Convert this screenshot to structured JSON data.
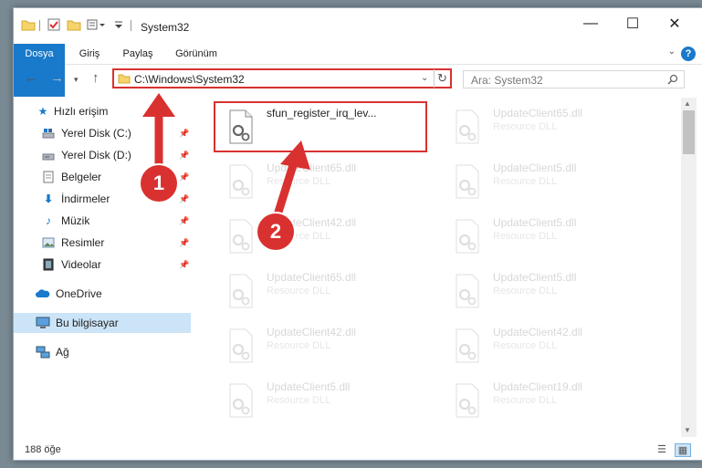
{
  "window": {
    "title": "System32",
    "minimize": "—",
    "maximize": "☐",
    "close": "✕"
  },
  "ribbon": {
    "tabs": [
      "Dosya",
      "Giriş",
      "Paylaş",
      "Görünüm"
    ],
    "help": "?",
    "collapse": "⌄"
  },
  "nav": {
    "address": "C:\\Windows\\System32",
    "search_placeholder": "Ara: System32"
  },
  "sidebar": {
    "items": [
      {
        "label": "Hızlı erişim",
        "icon": "star-icon",
        "pinned": false
      },
      {
        "label": "Yerel Disk (C:)",
        "icon": "drive-icon",
        "pinned": true
      },
      {
        "label": "Yerel Disk (D:)",
        "icon": "drive-icon",
        "pinned": true
      },
      {
        "label": "Belgeler",
        "icon": "documents-icon",
        "pinned": true
      },
      {
        "label": "İndirmeler",
        "icon": "download-icon",
        "pinned": true
      },
      {
        "label": "Müzik",
        "icon": "music-icon",
        "pinned": true
      },
      {
        "label": "Resimler",
        "icon": "pictures-icon",
        "pinned": true
      },
      {
        "label": "Videolar",
        "icon": "videos-icon",
        "pinned": true
      },
      {
        "label": "OneDrive",
        "icon": "cloud-icon",
        "pinned": false
      },
      {
        "label": "Bu bilgisayar",
        "icon": "computer-icon",
        "pinned": false,
        "selected": true
      },
      {
        "label": "Ağ",
        "icon": "network-icon",
        "pinned": false
      }
    ]
  },
  "files": [
    {
      "name": "sfun_register_irq_lev...",
      "type": ""
    },
    {
      "name": "UpdateClient65.dll",
      "type": "Resource DLL"
    },
    {
      "name": "UpdateClient65.dll",
      "type": "Resource DLL"
    },
    {
      "name": "UpdateClient5.dll",
      "type": "Resource DLL"
    },
    {
      "name": "UpdateClient42.dll",
      "type": "Resource DLL"
    },
    {
      "name": "UpdateClient5.dll",
      "type": "Resource DLL"
    },
    {
      "name": "UpdateClient65.dll",
      "type": "Resource DLL"
    },
    {
      "name": "UpdateClient5.dll",
      "type": "Resource DLL"
    },
    {
      "name": "UpdateClient42.dll",
      "type": "Resource DLL"
    },
    {
      "name": "UpdateClient42.dll",
      "type": "Resource DLL"
    },
    {
      "name": "UpdateClient5.dll",
      "type": "Resource DLL"
    },
    {
      "name": "UpdateClient19.dll",
      "type": "Resource DLL"
    }
  ],
  "status": {
    "item_count": "188 öğe"
  },
  "annotations": {
    "step1": "1",
    "step2": "2"
  },
  "colors": {
    "accent": "#1979ca",
    "highlight": "#d9312f",
    "selection": "#cce4f7"
  }
}
